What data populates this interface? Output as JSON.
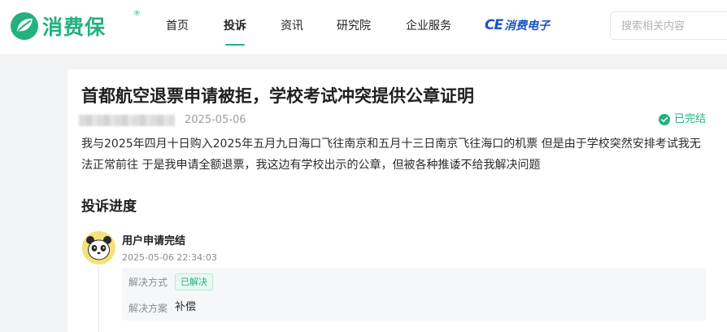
{
  "header": {
    "logo_text": "消费保",
    "logo_reg": "®",
    "nav": [
      {
        "label": "首页"
      },
      {
        "label": "投诉"
      },
      {
        "label": "资讯"
      },
      {
        "label": "研究院"
      },
      {
        "label": "企业服务"
      }
    ],
    "brand": {
      "ce": "CE",
      "label": "消费电子"
    },
    "search_placeholder": "搜索相关内容",
    "accent_color": "#22b27c"
  },
  "complaint": {
    "title": "首都航空退票申请被拒，学校考试冲突提供公章证明",
    "date": "2025-05-06",
    "status": "已完结",
    "content": "我与2025年四月十日购入2025年五月九日海口飞往南京和五月十三日南京飞往海口的机票 但是由于学校突然安排考试我无法正常前往 于是我申请全额退票，我这边有学校出示的公章，但被各种推诿不给我解决问题"
  },
  "progress": {
    "section_title": "投诉进度",
    "steps": [
      {
        "title": "用户申请完结",
        "time": "2025-05-06 22:34:03",
        "method_label": "解决方式",
        "method_value": "已解决",
        "plan_label": "解决方案",
        "plan_value": "补偿"
      }
    ]
  }
}
